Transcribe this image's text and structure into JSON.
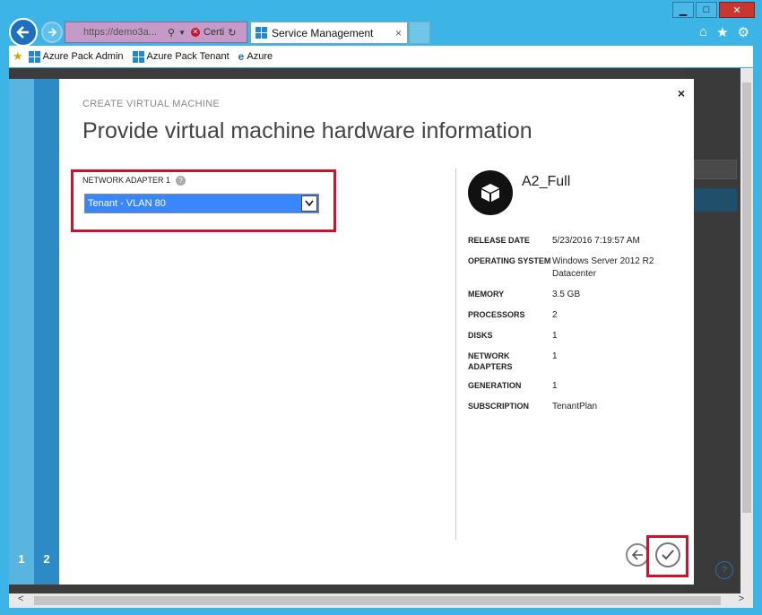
{
  "browser": {
    "address_url": "https://demo3a...",
    "cert_label": "Certi",
    "tab_title": "Service Management",
    "tab_close": "×",
    "favorites": [
      {
        "label": "Azure Pack Admin",
        "icon": "windows-icon"
      },
      {
        "label": "Azure Pack Tenant",
        "icon": "windows-icon"
      },
      {
        "label": "Azure",
        "icon": "ie-icon"
      }
    ]
  },
  "wizard": {
    "steps": [
      "1",
      "2"
    ],
    "subtitle": "CREATE VIRTUAL MACHINE",
    "title": "Provide virtual machine hardware information",
    "close_label": "×",
    "network_adapter_label": "NETWORK ADAPTER 1",
    "help_glyph": "?",
    "network_adapter_value": "Tenant - VLAN 80"
  },
  "vm": {
    "name": "A2_Full",
    "properties": [
      {
        "key": "RELEASE DATE",
        "value": "5/23/2016 7:19:57 AM"
      },
      {
        "key": "OPERATING SYSTEM",
        "value": "Windows Server 2012 R2 Datacenter"
      },
      {
        "key": "MEMORY",
        "value": "3.5 GB"
      },
      {
        "key": "PROCESSORS",
        "value": "2"
      },
      {
        "key": "DISKS",
        "value": "1"
      },
      {
        "key": "NETWORK ADAPTERS",
        "value": "1"
      },
      {
        "key": "GENERATION",
        "value": "1"
      },
      {
        "key": "SUBSCRIPTION",
        "value": "TenantPlan"
      }
    ]
  },
  "colors": {
    "accent_blue": "#2e8ac5",
    "highlight_red": "#d0102c",
    "selection_blue": "#3a86ff"
  }
}
